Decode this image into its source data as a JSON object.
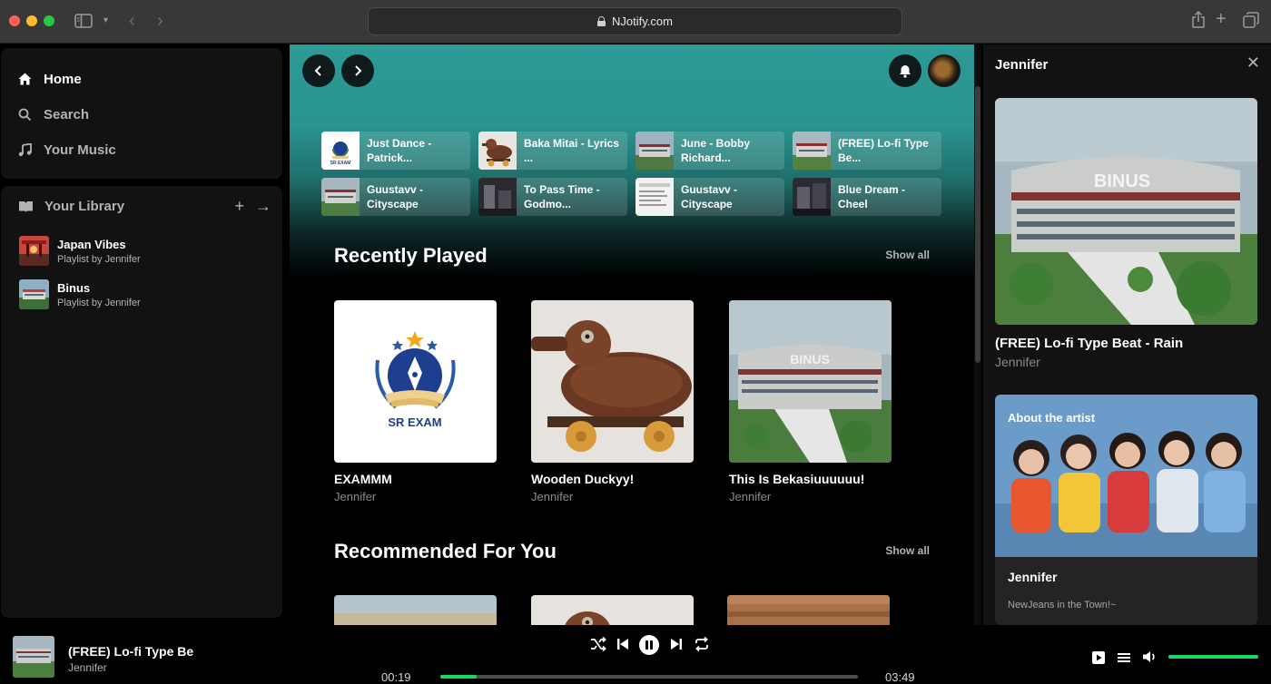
{
  "browser": {
    "url": "NJotify.com"
  },
  "nav": {
    "items": [
      {
        "label": "Home",
        "icon": "home-icon",
        "active": true
      },
      {
        "label": "Search",
        "icon": "search-icon",
        "active": false
      },
      {
        "label": "Your Music",
        "icon": "music-note-icon",
        "active": false
      }
    ]
  },
  "library": {
    "title": "Your Library",
    "playlists": [
      {
        "title": "Japan Vibes",
        "subtitle": "Playlist by Jennifer"
      },
      {
        "title": "Binus",
        "subtitle": "Playlist by Jennifer"
      }
    ]
  },
  "quick_tiles": [
    {
      "label": "Just Dance - Patrick..."
    },
    {
      "label": "Baka Mitai - Lyrics ..."
    },
    {
      "label": "June - Bobby Richard..."
    },
    {
      "label": "(FREE) Lo-fi Type Be..."
    },
    {
      "label": "Guustavv - Cityscape"
    },
    {
      "label": "To Pass Time - Godmo..."
    },
    {
      "label": "Guustavv - Cityscape"
    },
    {
      "label": "Blue Dream - Cheel"
    }
  ],
  "recently_played": {
    "title": "Recently Played",
    "show_all": "Show all",
    "cards": [
      {
        "title": "EXAMMM",
        "artist": "Jennifer"
      },
      {
        "title": "Wooden Duckyy!",
        "artist": "Jennifer"
      },
      {
        "title": "This Is Bekasiuuuuuu!",
        "artist": "Jennifer"
      }
    ]
  },
  "recommended": {
    "title": "Recommended For You",
    "show_all": "Show all"
  },
  "artwork": {
    "exam_logo_text": "SR EXAM",
    "binus_building_text": "BINUS",
    "tile_small_text": "SR EXAM"
  },
  "right_panel": {
    "title": "Jennifer",
    "song": "(FREE) Lo-fi Type Beat - Rain",
    "artist": "Jennifer",
    "about_label": "About the artist",
    "about_name": "Jennifer",
    "about_desc": "NewJeans in the Town!~"
  },
  "player": {
    "title": "(FREE) Lo-fi Type Be",
    "artist": "Jennifer",
    "current_time": "00:19",
    "total_time": "03:49",
    "progress": 0.087,
    "volume": 1.0
  },
  "colors": {
    "accent": "#1ed760",
    "header_teal": "#2c9a96"
  }
}
